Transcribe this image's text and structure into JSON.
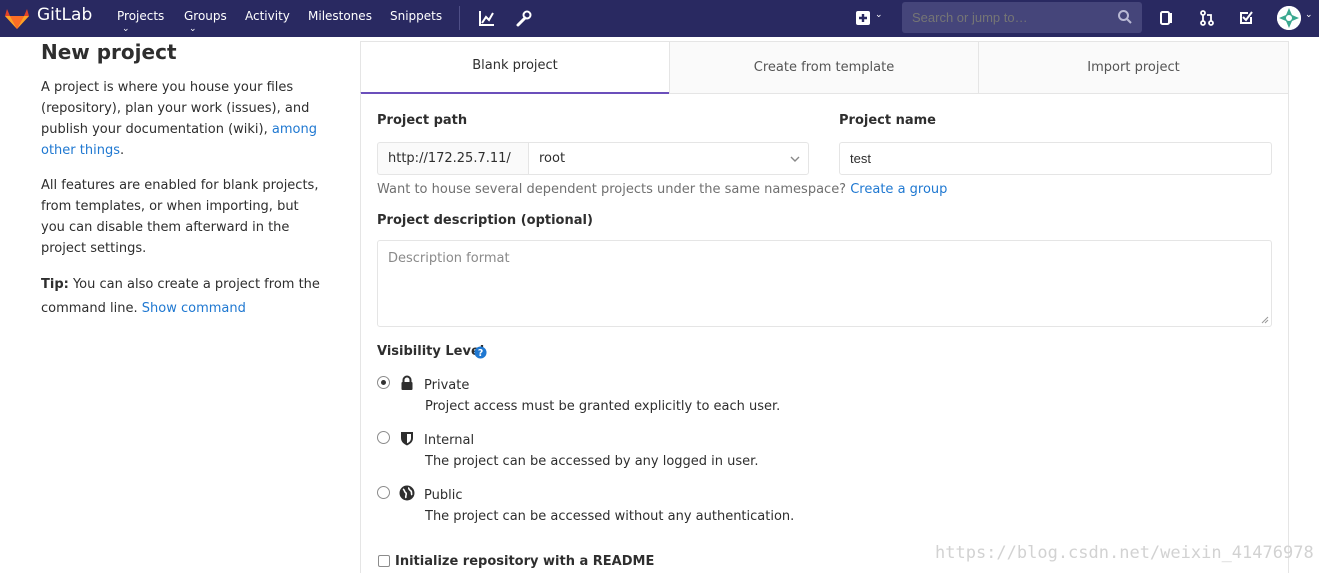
{
  "navbar": {
    "brand": "GitLab",
    "links": [
      "Projects",
      "Groups",
      "Activity",
      "Milestones",
      "Snippets"
    ],
    "search_placeholder": "Search or jump to…",
    "icons": [
      "admin-chart-icon",
      "wrench-icon",
      "new-plus-icon",
      "chevron-down-icon",
      "issues-icon",
      "merge-request-icon",
      "todo-check-icon",
      "user-avatar"
    ]
  },
  "sidebar": {
    "title": "New project",
    "intro_prefix": "A project is where you house your files (repository), plan your work (issues), and publish your documentation (wiki),",
    "intro_link": "among other things",
    "intro_suffix": ".",
    "features_text": "All features are enabled for blank projects, from templates, or when importing, but you can disable them afterward in the project settings.",
    "tip_label": "Tip:",
    "tip_text": "You can also create a project from the command line.",
    "tip_link": "Show command"
  },
  "tabs": [
    "Blank project",
    "Create from template",
    "Import project"
  ],
  "form": {
    "path_label": "Project path",
    "path_prefix": "http://172.25.7.11/",
    "namespace": "root",
    "name_label": "Project name",
    "name_value": "test",
    "group_help": "Want to house several dependent projects under the same namespace?",
    "group_link": "Create a group",
    "desc_label": "Project description (optional)",
    "desc_placeholder": "Description format",
    "visibility_label": "Visibility Level",
    "visibility": [
      {
        "title": "Private",
        "desc": "Project access must be granted explicitly to each user.",
        "icon": "lock-icon",
        "checked": true
      },
      {
        "title": "Internal",
        "desc": "The project can be accessed by any logged in user.",
        "icon": "shield-icon",
        "checked": false
      },
      {
        "title": "Public",
        "desc": "The project can be accessed without any authentication.",
        "icon": "globe-icon",
        "checked": false
      }
    ],
    "readme_label": "Initialize repository with a README"
  },
  "watermark": "https://blog.csdn.net/weixin_41476978",
  "colors": {
    "navbar": "#292961",
    "link": "#1f78d1",
    "active_tab": "#6b4fbb"
  }
}
